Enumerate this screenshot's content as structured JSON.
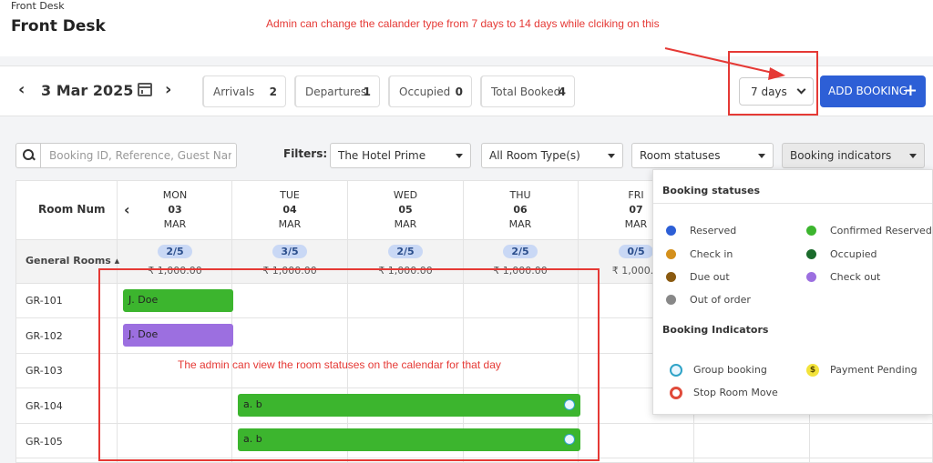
{
  "header": {
    "breadcrumb": "Front Desk",
    "title": "Front Desk"
  },
  "annotations": {
    "days_note": "Admin can change the calander type from 7 days to 14 days while clciking on this",
    "calendar_note": "The admin can view the room statuses on the calendar for that day"
  },
  "toolbar": {
    "date": "3 Mar 2025",
    "stats": [
      {
        "label": "Arrivals",
        "count": "2",
        "color": "#4ab3c4"
      },
      {
        "label": "Departures",
        "count": "1",
        "color": "#d9534f"
      },
      {
        "label": "Occupied",
        "count": "0",
        "color": "#8e44ad"
      },
      {
        "label": "Total Booked",
        "count": "4",
        "color": "#4caf50"
      }
    ],
    "days_select": "7 days",
    "add_booking": "ADD BOOKING"
  },
  "filters": {
    "search_placeholder": "Booking ID, Reference, Guest Name or",
    "label": "Filters:",
    "hotel": "The Hotel Prime",
    "room_type": "All Room Type(s)",
    "room_status": "Room statuses",
    "indicators": "Booking indicators"
  },
  "calendar": {
    "room_num_header": "Room Num",
    "days": [
      {
        "dow": "MON",
        "day": "03",
        "month": "MAR",
        "occupancy": "2/5",
        "price": "₹ 1,000.00"
      },
      {
        "dow": "TUE",
        "day": "04",
        "month": "MAR",
        "occupancy": "3/5",
        "price": "₹ 1,000.00"
      },
      {
        "dow": "WED",
        "day": "05",
        "month": "MAR",
        "occupancy": "2/5",
        "price": "₹ 1,000.00"
      },
      {
        "dow": "THU",
        "day": "06",
        "month": "MAR",
        "occupancy": "2/5",
        "price": "₹ 1,000.00"
      },
      {
        "dow": "FRI",
        "day": "07",
        "month": "MAR",
        "occupancy": "0/5",
        "price": "₹ 1,000.0"
      }
    ],
    "group_label": "General Rooms",
    "rooms": [
      "GR-101",
      "GR-102",
      "GR-103",
      "GR-104",
      "GR-105"
    ],
    "bookings": [
      {
        "guest": "J. Doe",
        "color": "#3cb52e"
      },
      {
        "guest": "J. Doe",
        "color": "#9c6fe0"
      },
      {
        "guest": "a. b",
        "color": "#3cb52e"
      },
      {
        "guest": "a. b",
        "color": "#3cb52e"
      }
    ]
  },
  "legend_panel": {
    "statuses_title": "Booking statuses",
    "statuses": [
      {
        "label": "Reserved",
        "color": "#2d5fd6"
      },
      {
        "label": "Confirmed Reserved",
        "color": "#3cb52e"
      },
      {
        "label": "Check in",
        "color": "#d4901c"
      },
      {
        "label": "Occupied",
        "color": "#1b6b2c"
      },
      {
        "label": "Due out",
        "color": "#8a5a10"
      },
      {
        "label": "Check out",
        "color": "#9c6fe0"
      },
      {
        "label": "Out of order",
        "color": "#888888"
      }
    ],
    "indicators_title": "Booking Indicators",
    "indicators": [
      {
        "label": "Group booking",
        "icon": "group-icon"
      },
      {
        "label": "Payment Pending",
        "icon": "dollar-icon"
      },
      {
        "label": "Stop Room Move",
        "icon": "stop-icon"
      }
    ]
  }
}
